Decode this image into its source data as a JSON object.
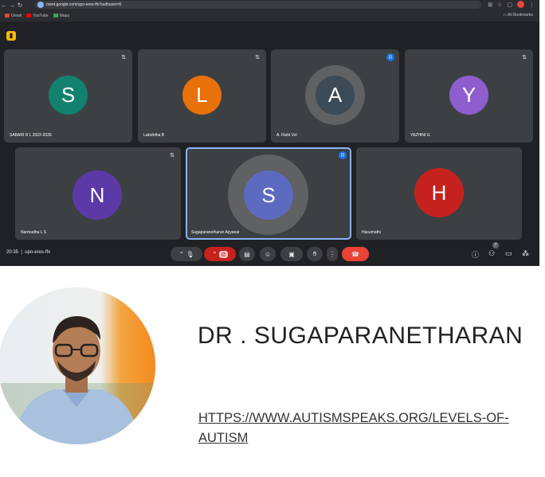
{
  "browser": {
    "url": "meet.google.com/upo-eres-ffx?authuser=0",
    "bookmarks": [
      {
        "label": "Gmail",
        "color": "#ea4335"
      },
      {
        "label": "YouTube",
        "color": "#ff0000"
      },
      {
        "label": "Maps",
        "color": "#34a853"
      }
    ],
    "all_bookmarks_label": "All Bookmarks"
  },
  "meeting": {
    "time": "20:35",
    "code": "upo-eres-ffx",
    "participant_count": "7",
    "participants": [
      {
        "name": "SABARI R L 2022-2026",
        "initial": "S",
        "color": "#12826f",
        "mic": "muted"
      },
      {
        "name": "Lakshitha B",
        "initial": "L",
        "color": "#e8710a",
        "mic": "muted"
      },
      {
        "name": "A. Rishi Vol",
        "initial": "A",
        "color": "#3b4a54",
        "mic": "speaking"
      },
      {
        "name": "YAZHINI G",
        "initial": "Y",
        "color": "#8e5ecf",
        "mic": "muted"
      },
      {
        "name": "Narmadha L S",
        "initial": "N",
        "color": "#5b3aa8",
        "mic": "muted"
      },
      {
        "name": "Sugaparanetharan Ayyanar",
        "initial": "S",
        "color": "#5c6bc0",
        "mic": "speaking"
      },
      {
        "name": "Hasumathi",
        "initial": "H",
        "color": "#c5221f",
        "mic": "none"
      }
    ]
  },
  "slide": {
    "speaker_name": "DR . SUGAPARANETHARAN",
    "link_text": "HTTPS://WWW.AUTISMSPEAKS.ORG/LEVELS-OF-AUTISM"
  }
}
